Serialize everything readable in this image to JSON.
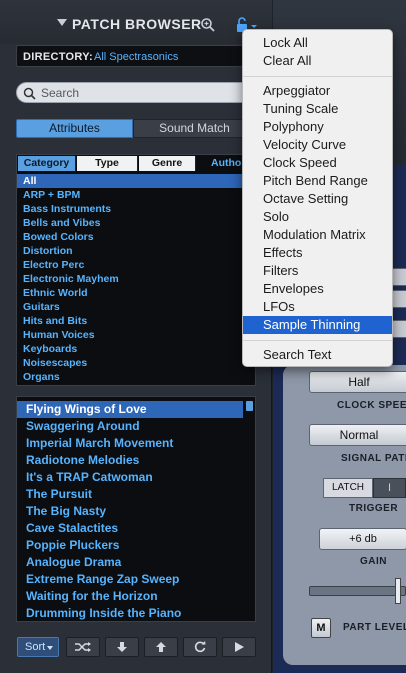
{
  "browser": {
    "title": "PATCH BROWSER",
    "directory_label": "DIRECTORY:",
    "directory_value": "All Spectrasonics",
    "search_placeholder": "Search",
    "tabs": {
      "attributes": "Attributes",
      "sound_match": "Sound Match"
    },
    "columns": {
      "category": "Category",
      "type": "Type",
      "genre": "Genre",
      "author": "Author"
    },
    "categories": [
      "All",
      "ARP + BPM",
      "Bass Instruments",
      "Bells and Vibes",
      "Bowed Colors",
      "Distortion",
      "Electro Perc",
      "Electronic Mayhem",
      "Ethnic World",
      "Guitars",
      "Hits and Bits",
      "Human Voices",
      "Keyboards",
      "Noisescapes",
      "Organs"
    ],
    "patches": [
      "Flying Wings of Love",
      "Swaggering Around",
      "Imperial March Movement",
      "Radiotone Melodies",
      "It's a TRAP Catwoman",
      "The Pursuit",
      "The Big Nasty",
      "Cave Stalactites",
      "Poppie Pluckers",
      "Analogue Drama",
      "Extreme Range Zap Sweep",
      "Waiting for the Horizon",
      "Drumming Inside the Piano"
    ],
    "sort_label": "Sort"
  },
  "right": {
    "half_label": "Half",
    "clock_speed_label": "CLOCK SPEED",
    "normal_label": "Normal",
    "signal_path_label": "SIGNAL PATH",
    "latch_label": "LATCH",
    "latch_toggle": "I",
    "trigger_label": "TRIGGER",
    "gain_value": "+6 db",
    "gain_label": "GAIN",
    "m_label": "M",
    "part_level_label": "PART LEVEL"
  },
  "menu": {
    "items": [
      "Lock All",
      "Clear All",
      "Arpeggiator",
      "Tuning Scale",
      "Polyphony",
      "Velocity Curve",
      "Clock Speed",
      "Pitch Bend Range",
      "Octave Setting",
      "Solo",
      "Modulation Matrix",
      "Effects",
      "Filters",
      "Envelopes",
      "LFOs",
      "Sample Thinning",
      "Search Text"
    ],
    "highlighted": "Sample Thinning"
  },
  "colors": {
    "accent": "#56b4ff",
    "selection": "#2e66b8",
    "menu_highlight": "#1f63d1"
  }
}
